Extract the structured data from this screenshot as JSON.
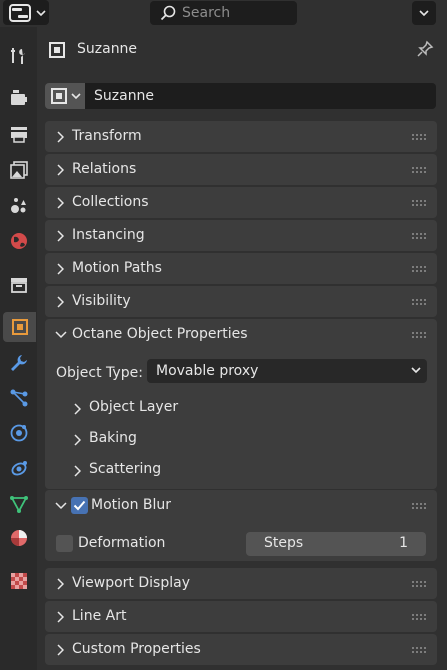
{
  "header": {
    "search_placeholder": "Search"
  },
  "object": {
    "title": "Suzanne",
    "name_value": "Suzanne"
  },
  "panels": {
    "transform": "Transform",
    "relations": "Relations",
    "collections": "Collections",
    "instancing": "Instancing",
    "motion_paths": "Motion Paths",
    "visibility": "Visibility",
    "octane": "Octane Object Properties",
    "motion_blur": "Motion Blur",
    "viewport_display": "Viewport Display",
    "line_art": "Line Art",
    "custom_properties": "Custom Properties"
  },
  "octane": {
    "object_type_label": "Object Type:",
    "object_type_value": "Movable proxy",
    "subpanels": [
      "Object Layer",
      "Baking",
      "Scattering"
    ]
  },
  "motion_blur": {
    "enabled": true,
    "deformation_label": "Deformation",
    "deformation_enabled": false,
    "steps_label": "Steps",
    "steps_value": "1"
  },
  "tabs": [
    "tool-tab",
    "render-tab",
    "output-tab",
    "view-layer-tab",
    "scene-tab",
    "world-tab",
    "collection-tab",
    "object-tab",
    "modifiers-tab",
    "particles-tab",
    "physics-tab",
    "constraints-tab",
    "data-tab",
    "material-tab",
    "texture-tab"
  ],
  "colors": {
    "accent": "#4772b3",
    "active_tab": "#4a4a4a",
    "panel": "#3d3d3d",
    "background": "#303030"
  }
}
